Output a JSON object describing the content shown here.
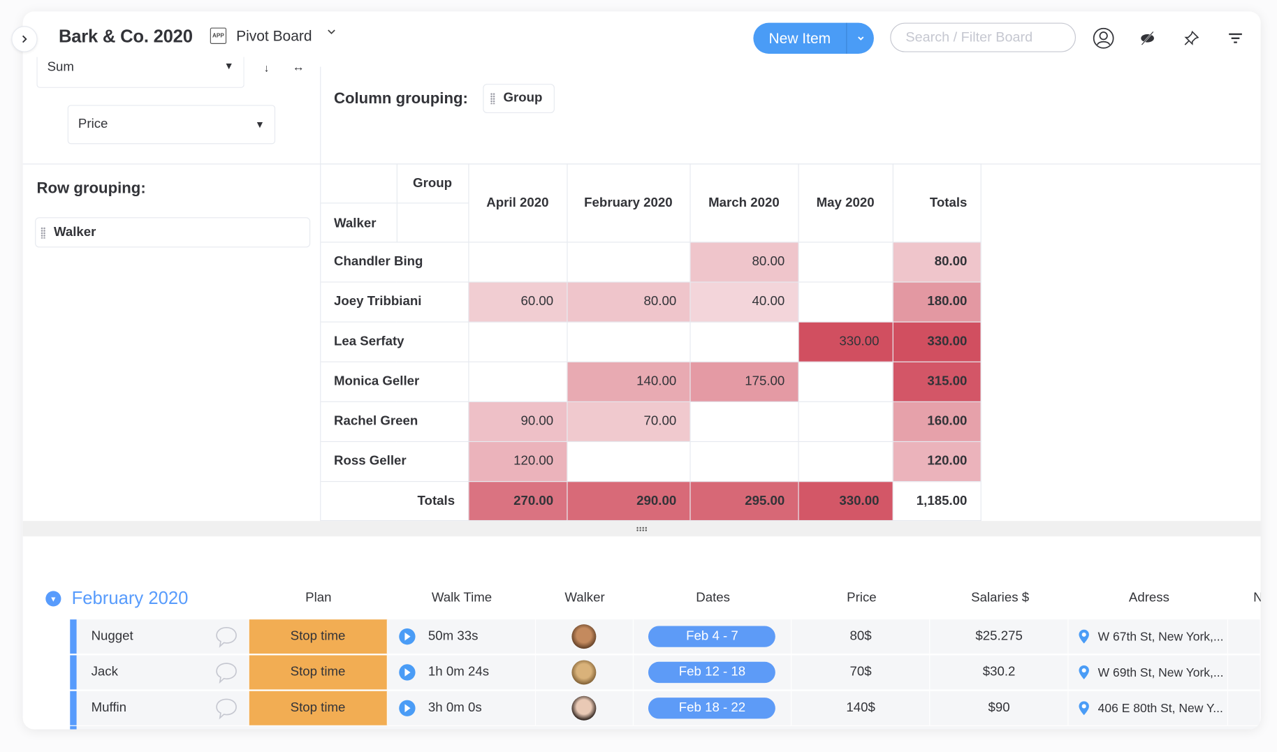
{
  "header": {
    "board_title": "Bark & Co. 2020",
    "view_icon_text": "APP",
    "view_name": "Pivot Board",
    "new_item_label": "New Item",
    "search_placeholder": "Search / Filter Board",
    "icons": [
      "person-icon",
      "hide-icon",
      "pin-icon",
      "filter-icon"
    ]
  },
  "config": {
    "aggregation": "Sum",
    "value_column": "Price",
    "column_grouping_label": "Column grouping:",
    "column_grouping_chip": "Group",
    "row_grouping_label": "Row grouping:",
    "row_grouping_chip": "Walker"
  },
  "pivot": {
    "corner_col_label": "Group",
    "corner_row_label": "Walker",
    "columns": [
      "April 2020",
      "February 2020",
      "March 2020",
      "May 2020",
      "Totals"
    ],
    "rows": [
      {
        "name": "Chandler Bing",
        "cells": [
          "",
          "",
          "80.00",
          "",
          "80.00"
        ]
      },
      {
        "name": "Joey Tribbiani",
        "cells": [
          "60.00",
          "80.00",
          "40.00",
          "",
          "180.00"
        ]
      },
      {
        "name": "Lea Serfaty",
        "cells": [
          "",
          "",
          "",
          "330.00",
          "330.00"
        ]
      },
      {
        "name": "Monica Geller",
        "cells": [
          "",
          "140.00",
          "175.00",
          "",
          "315.00"
        ]
      },
      {
        "name": "Rachel Green",
        "cells": [
          "90.00",
          "70.00",
          "",
          "",
          "160.00"
        ]
      },
      {
        "name": "Ross Geller",
        "cells": [
          "120.00",
          "",
          "",
          "",
          "120.00"
        ]
      }
    ],
    "totals_label": "Totals",
    "totals": [
      "270.00",
      "290.00",
      "295.00",
      "330.00",
      "1,185.00"
    ],
    "heat_colors": {
      "low": "#f7e4e7",
      "mid": "#e6a3ad",
      "high": "#d14f60"
    }
  },
  "board": {
    "group_title": "February 2020",
    "group_color": "#579bfc",
    "columns": [
      "Plan",
      "Walk Time",
      "Walker",
      "Dates",
      "Price",
      "Salaries $",
      "Adress",
      "N"
    ],
    "items": [
      {
        "name": "Nugget",
        "plan": "Stop time",
        "walk_time": "50m 33s",
        "dates": "Feb 4 - 7",
        "price": "80$",
        "salary": "$25.275",
        "address": "W 67th St, New York,..."
      },
      {
        "name": "Jack",
        "plan": "Stop time",
        "walk_time": "1h 0m 24s",
        "dates": "Feb 12 - 18",
        "price": "70$",
        "salary": "$30.2",
        "address": "W 69th St, New York,..."
      },
      {
        "name": "Muffin",
        "plan": "Stop time",
        "walk_time": "3h 0m 0s",
        "dates": "Feb 18 - 22",
        "price": "140$",
        "salary": "$90",
        "address": "406 E 80th St, New Y..."
      }
    ]
  }
}
